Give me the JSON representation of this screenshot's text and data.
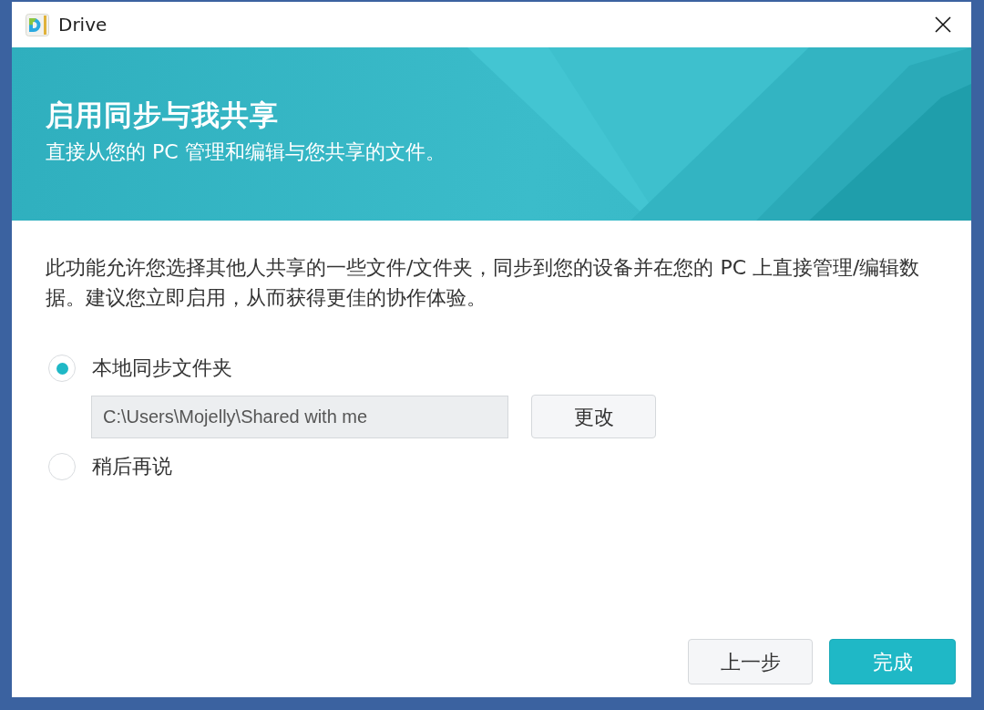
{
  "window": {
    "title": "Drive"
  },
  "banner": {
    "title": "启用同步与我共享",
    "subtitle": "直接从您的 PC 管理和编辑与您共享的文件。"
  },
  "description": "此功能允许您选择其他人共享的一些文件/文件夹，同步到您的设备并在您的 PC 上直接管理/编辑数据。建议您立即启用，从而获得更佳的协作体验。",
  "options": [
    {
      "label": "本地同步文件夹",
      "selected": true,
      "folder": {
        "value": "C:\\Users\\Mojelly\\Shared with me",
        "button": "更改"
      }
    },
    {
      "label": "稍后再说",
      "selected": false
    }
  ],
  "buttons": [
    {
      "label": "上一步",
      "kind": "secondary"
    },
    {
      "label": "完成",
      "kind": "primary"
    }
  ]
}
